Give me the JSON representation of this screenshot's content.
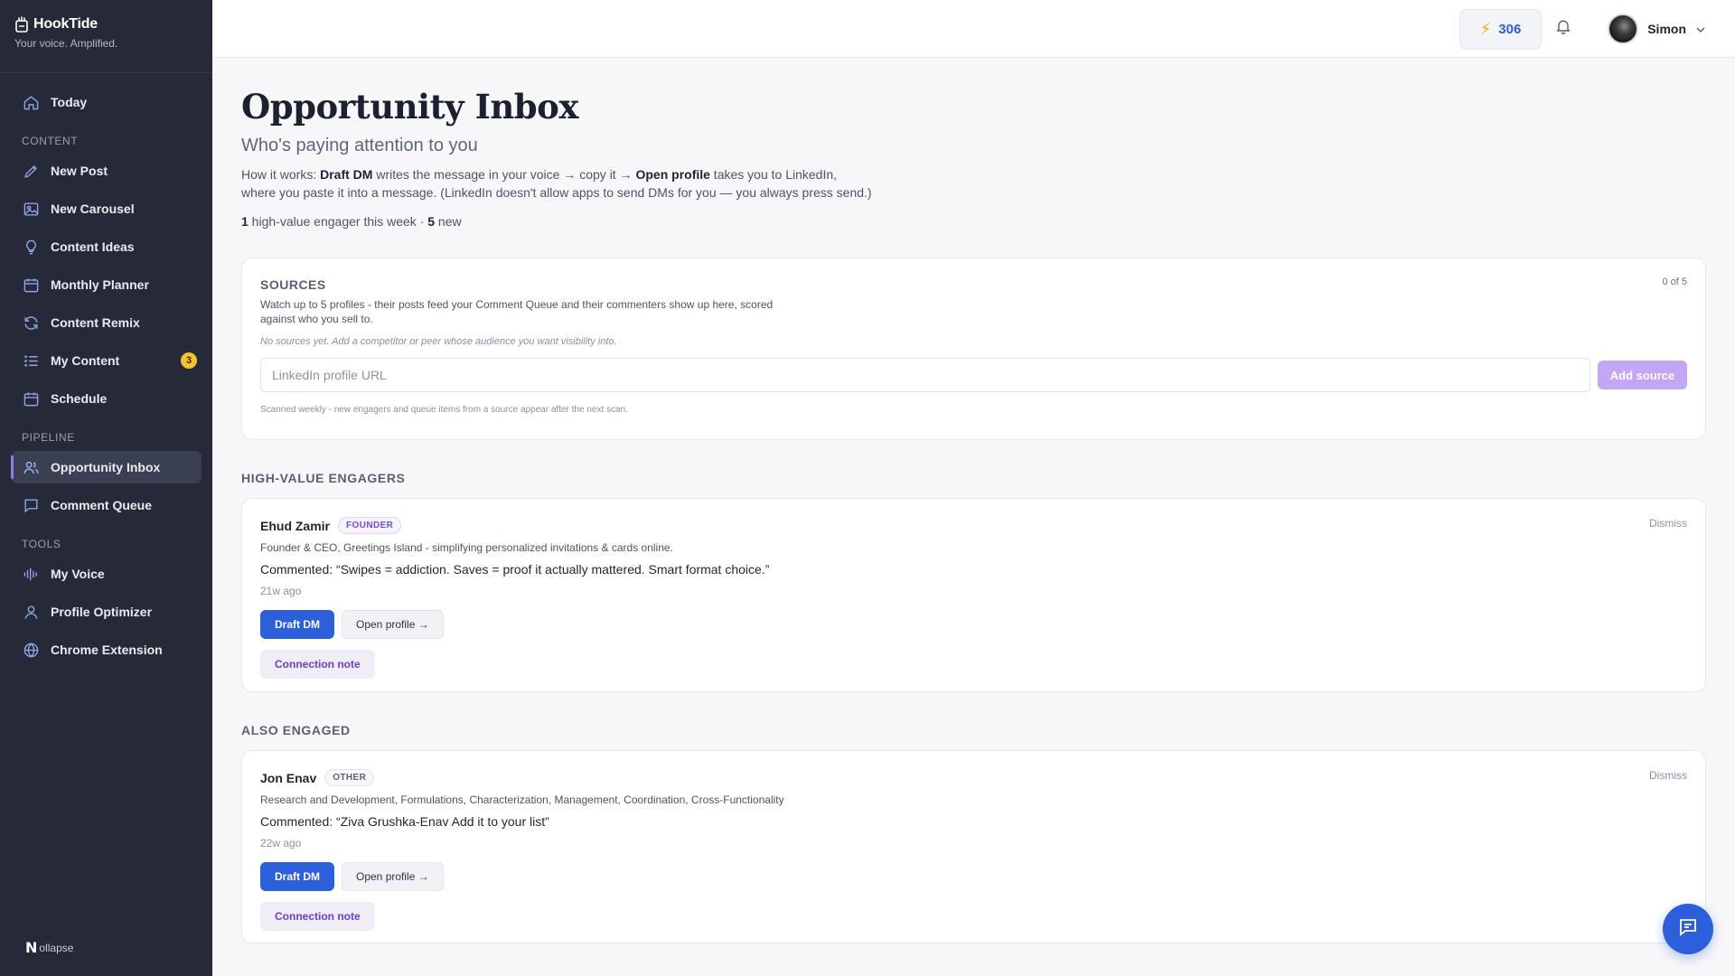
{
  "brand": {
    "name": "HookTide",
    "tagline": "Your voice. Amplified."
  },
  "sidebar": {
    "top": [
      {
        "label": "Today",
        "icon": "home-icon"
      }
    ],
    "sections": [
      {
        "label": "CONTENT",
        "items": [
          {
            "label": "New Post",
            "icon": "pencil-icon"
          },
          {
            "label": "New Carousel",
            "icon": "image-icon"
          },
          {
            "label": "Content Ideas",
            "icon": "lightbulb-icon"
          },
          {
            "label": "Monthly Planner",
            "icon": "calendar-icon"
          },
          {
            "label": "Content Remix",
            "icon": "refresh-icon"
          },
          {
            "label": "My Content",
            "icon": "list-icon",
            "badge": "3"
          },
          {
            "label": "Schedule",
            "icon": "calendar-icon"
          }
        ]
      },
      {
        "label": "PIPELINE",
        "items": [
          {
            "label": "Opportunity Inbox",
            "icon": "users-icon",
            "active": true
          },
          {
            "label": "Comment Queue",
            "icon": "message-icon"
          }
        ]
      },
      {
        "label": "TOOLS",
        "items": [
          {
            "label": "My Voice",
            "icon": "waveform-icon"
          },
          {
            "label": "Profile Optimizer",
            "icon": "user-icon"
          },
          {
            "label": "Chrome Extension",
            "icon": "globe-icon"
          }
        ]
      }
    ],
    "collapse_label": "ollapse",
    "collapse_glyph": "N"
  },
  "topbar": {
    "credits": "306",
    "credits_icon": "bolt-icon",
    "user_name": "Simon"
  },
  "page": {
    "title": "Opportunity Inbox",
    "subtitle": "Who's paying attention to you",
    "howto": {
      "prefix": "How it works: ",
      "draft_dm": "Draft DM",
      "middle": " writes the message in your voice → copy it → ",
      "open_profile": "Open profile",
      "suffix": " takes you to LinkedIn, where you paste it into a message. (LinkedIn doesn't allow apps to send DMs for you — you always press send.)"
    },
    "stats": {
      "high_value_count": "1",
      "high_value_text": " high-value engager this week · ",
      "new_count": "5",
      "new_text": " new"
    }
  },
  "sources": {
    "title": "SOURCES",
    "count": "0 of 5",
    "description": "Watch up to 5 profiles - their posts feed your Comment Queue and their commenters show up here, scored against who you sell to.",
    "empty_text": "No sources yet. Add a competitor or peer whose audience you want visibility into.",
    "input_placeholder": "LinkedIn profile URL",
    "add_label": "Add source",
    "note": "Scanned weekly - new engagers and queue items from a source appear after the next scan."
  },
  "high_value": {
    "heading": "HIGH-VALUE ENGAGERS",
    "engagers": [
      {
        "name": "Ehud Zamir",
        "tag": "FOUNDER",
        "role": "Founder & CEO, Greetings Island - simplifying personalized invitations & cards online.",
        "comment": "Commented: “Swipes = addiction. Saves = proof it actually mattered. Smart format choice.”",
        "time": "21w ago",
        "dismiss": "Dismiss",
        "draft_label": "Draft DM",
        "open_label": "Open profile →",
        "note_label": "Connection note"
      }
    ]
  },
  "also_engaged": {
    "heading": "ALSO ENGAGED",
    "engagers": [
      {
        "name": "Jon Enav",
        "tag": "OTHER",
        "role": "Research and Development, Formulations, Characterization, Management, Coordination, Cross-Functionality",
        "comment": "Commented: “Ziva Grushka-Enav Add it to your list”",
        "time": "22w ago",
        "dismiss": "Dismiss",
        "draft_label": "Draft DM",
        "open_label": "Open profile →",
        "note_label": "Connection note"
      }
    ]
  },
  "colors": {
    "accent": "#2c5fd9",
    "sidebar_bg": "#262a38",
    "active_marker": "#8b7cf0",
    "badge": "#f3c233",
    "add_button": "#c3a6f5"
  }
}
